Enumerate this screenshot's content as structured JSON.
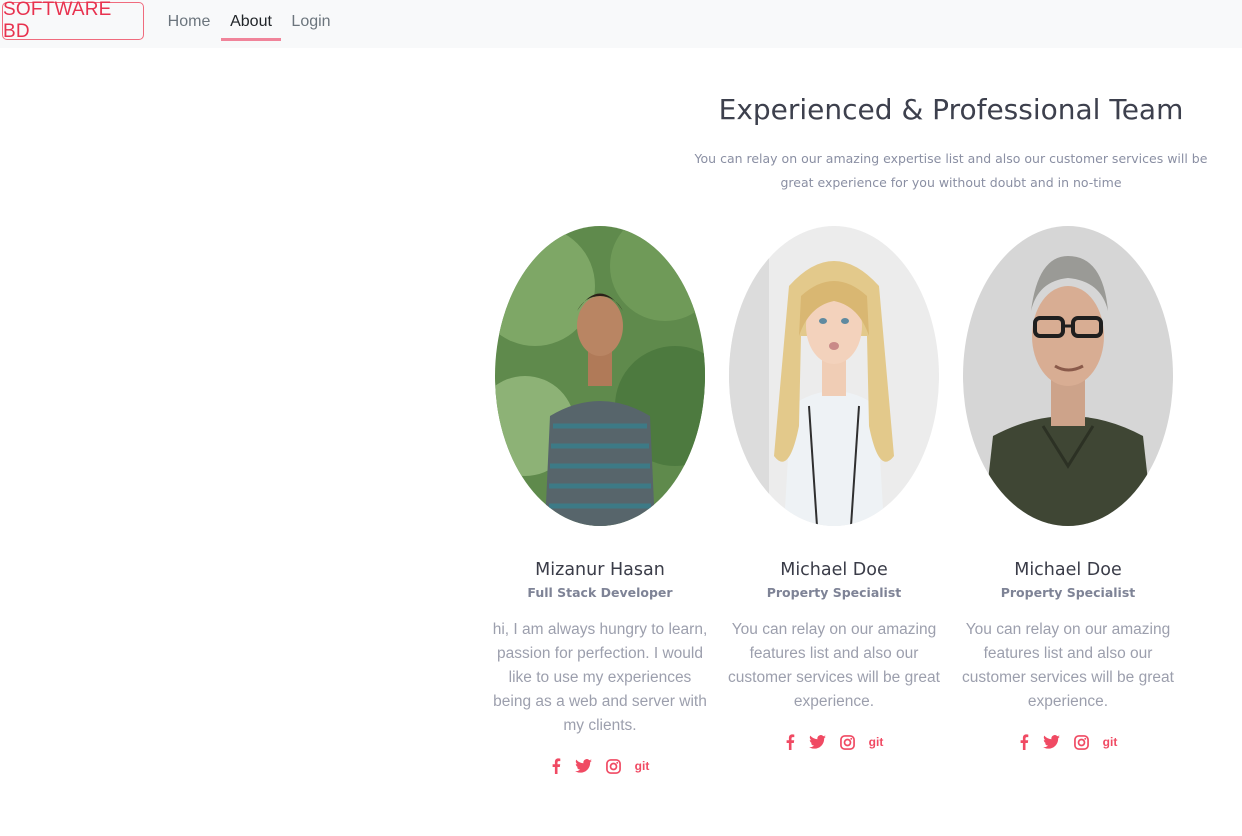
{
  "brand": "SOFTWARE BD",
  "nav": {
    "home": "Home",
    "about": "About",
    "login": "Login"
  },
  "section": {
    "title": "Experienced & Professional Team",
    "subtitle": "You can relay on our amazing expertise list and also our customer services will be great experience for you without doubt and in no-time"
  },
  "team": [
    {
      "name": "Mizanur Hasan",
      "role": "Full Stack Developer",
      "bio": "hi, I am always hungry to learn, passion for perfection. I would like to use my experiences being as a web and server with my clients.",
      "social": {
        "git": "git"
      }
    },
    {
      "name": "Michael Doe",
      "role": "Property Specialist",
      "bio": "You can relay on our amazing features list and also our customer services will be great experience.",
      "social": {
        "git": "git"
      }
    },
    {
      "name": "Michael Doe",
      "role": "Property Specialist",
      "bio": "You can relay on our amazing features list and also our customer services will be great experience.",
      "social": {
        "git": "git"
      }
    }
  ],
  "colors": {
    "accent": "#f04a63",
    "brand": "#e8324f",
    "navbar_bg": "#f8f9fa"
  },
  "icons": [
    "facebook-icon",
    "twitter-icon",
    "instagram-icon",
    "git-icon"
  ]
}
